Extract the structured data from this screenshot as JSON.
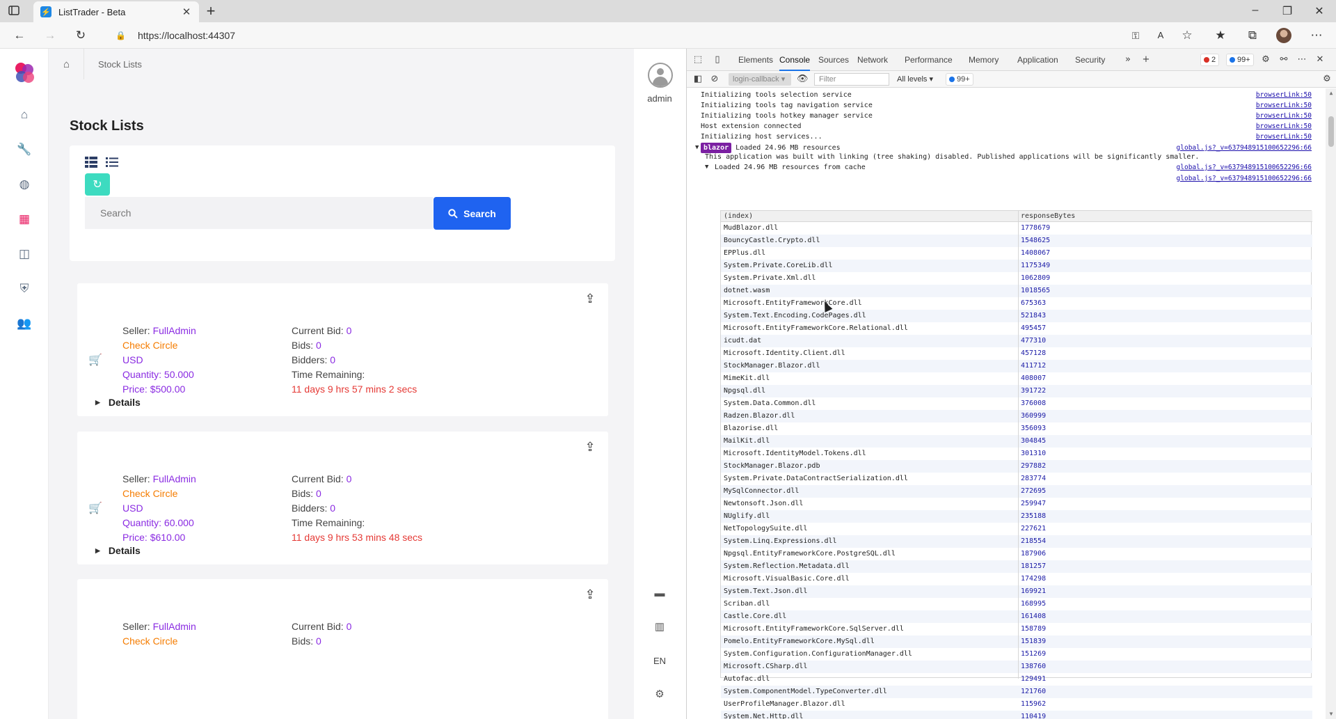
{
  "browser": {
    "tab_title": "ListTrader - Beta",
    "url": "https://localhost:44307"
  },
  "app": {
    "breadcrumb": "Stock Lists",
    "page_title": "Stock Lists",
    "search": {
      "placeholder": "Search",
      "value": "",
      "button_label": "Search"
    },
    "labels": {
      "seller": "Seller:",
      "current_bid": "Current Bid:",
      "bids": "Bids:",
      "bidders": "Bidders:",
      "quantity": "Quantity:",
      "time_remaining": "Time Remaining:",
      "price": "Price:",
      "details": "Details"
    },
    "listings": [
      {
        "seller": "FullAdmin",
        "status": "Check Circle",
        "currency": "USD",
        "quantity": "50.000",
        "price": "$500.00",
        "current_bid": "0",
        "bids": "0",
        "bidders": "0",
        "time_remaining": "11 days 9 hrs 57 mins 2 secs"
      },
      {
        "seller": "FullAdmin",
        "status": "Check Circle",
        "currency": "USD",
        "quantity": "60.000",
        "price": "$610.00",
        "current_bid": "0",
        "bids": "0",
        "bidders": "0",
        "time_remaining": "11 days 9 hrs 53 mins 48 secs"
      },
      {
        "seller": "FullAdmin",
        "status": "Check Circle",
        "current_bid": "0",
        "bids": "0"
      }
    ],
    "user": {
      "name": "admin"
    },
    "language": "EN",
    "colors": {
      "accent": "#1f63f0",
      "seller": "#8a2be2",
      "status": "#f57c00",
      "time": "#e53935",
      "refresh": "#3ddbc0"
    }
  },
  "devtools": {
    "tabs": [
      "Elements",
      "Console",
      "Sources",
      "Network",
      "Performance",
      "Memory",
      "Application",
      "Security"
    ],
    "active_tab": "Console",
    "error_count": "2",
    "info_count": "99+",
    "context": "login-callback",
    "filter_placeholder": "Filter",
    "levels": "All levels",
    "filterbar_badge": "99+",
    "logs": [
      {
        "text": "Initializing tools selection service",
        "src": "browserLink:50"
      },
      {
        "text": "Initializing tools tag navigation service",
        "src": "browserLink:50"
      },
      {
        "text": "Initializing tools hotkey manager service",
        "src": "browserLink:50"
      },
      {
        "text": "Host extension connected",
        "src": "browserLink:50"
      },
      {
        "text": "Initializing host services...",
        "src": "browserLink:50"
      }
    ],
    "blazor": {
      "badge": "blazor",
      "title": "Loaded 24.96 MB resources",
      "note": "This application was built with linking (tree shaking) disabled. Published applications will be significantly smaller.",
      "src": "global.js?_v=637948915100652296:66",
      "group": "Loaded 24.96 MB resources from cache",
      "group_src": "global.js?_v=637948915100652296:66",
      "table_src": "global.js?_v=637948915100652296:66"
    },
    "table": {
      "headers": [
        "(index)",
        "responseBytes"
      ],
      "rows": [
        [
          "MudBlazor.dll",
          "1778679"
        ],
        [
          "BouncyCastle.Crypto.dll",
          "1548625"
        ],
        [
          "EPPlus.dll",
          "1408067"
        ],
        [
          "System.Private.CoreLib.dll",
          "1175349"
        ],
        [
          "System.Private.Xml.dll",
          "1062809"
        ],
        [
          "dotnet.wasm",
          "1018565"
        ],
        [
          "Microsoft.EntityFrameworkCore.dll",
          "675363"
        ],
        [
          "System.Text.Encoding.CodePages.dll",
          "521843"
        ],
        [
          "Microsoft.EntityFrameworkCore.Relational.dll",
          "495457"
        ],
        [
          "icudt.dat",
          "477310"
        ],
        [
          "Microsoft.Identity.Client.dll",
          "457128"
        ],
        [
          "StockManager.Blazor.dll",
          "411712"
        ],
        [
          "MimeKit.dll",
          "408007"
        ],
        [
          "Npgsql.dll",
          "391722"
        ],
        [
          "System.Data.Common.dll",
          "376008"
        ],
        [
          "Radzen.Blazor.dll",
          "360999"
        ],
        [
          "Blazorise.dll",
          "356093"
        ],
        [
          "MailKit.dll",
          "304845"
        ],
        [
          "Microsoft.IdentityModel.Tokens.dll",
          "301310"
        ],
        [
          "StockManager.Blazor.pdb",
          "297882"
        ],
        [
          "System.Private.DataContractSerialization.dll",
          "283774"
        ],
        [
          "MySqlConnector.dll",
          "272695"
        ],
        [
          "Newtonsoft.Json.dll",
          "259947"
        ],
        [
          "NUglify.dll",
          "235188"
        ],
        [
          "NetTopologySuite.dll",
          "227621"
        ],
        [
          "System.Linq.Expressions.dll",
          "218554"
        ],
        [
          "Npgsql.EntityFrameworkCore.PostgreSQL.dll",
          "187906"
        ],
        [
          "System.Reflection.Metadata.dll",
          "181257"
        ],
        [
          "Microsoft.VisualBasic.Core.dll",
          "174298"
        ],
        [
          "System.Text.Json.dll",
          "169921"
        ],
        [
          "Scriban.dll",
          "168995"
        ],
        [
          "Castle.Core.dll",
          "161408"
        ],
        [
          "Microsoft.EntityFrameworkCore.SqlServer.dll",
          "158789"
        ],
        [
          "Pomelo.EntityFrameworkCore.MySql.dll",
          "151839"
        ],
        [
          "System.Configuration.ConfigurationManager.dll",
          "151269"
        ],
        [
          "Microsoft.CSharp.dll",
          "138760"
        ],
        [
          "Autofac.dll",
          "129491"
        ],
        [
          "System.ComponentModel.TypeConverter.dll",
          "121760"
        ],
        [
          "UserProfileManager.Blazor.dll",
          "115962"
        ],
        [
          "System.Net.Http.dll",
          "110419"
        ]
      ]
    }
  }
}
